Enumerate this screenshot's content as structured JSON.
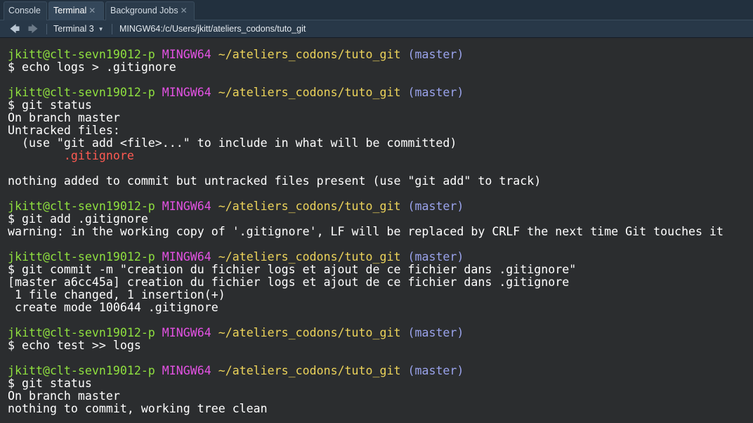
{
  "tabs": [
    {
      "label": "Console",
      "active": false,
      "closable": false
    },
    {
      "label": "Terminal",
      "active": true,
      "closable": true
    },
    {
      "label": "Background Jobs",
      "active": false,
      "closable": true
    }
  ],
  "toolbar": {
    "terminal_name": "Terminal 3",
    "path": "MINGW64:/c/Users/jkitt/ateliers_codons/tuto_git"
  },
  "prompt": {
    "user_host": "jkitt@clt-sevn19012-p",
    "env": "MINGW64",
    "cwd": "~/ateliers_codons/tuto_git",
    "branch": "(master)"
  },
  "lines": [
    "",
    "$ echo logs > .gitignore",
    "",
    "",
    "$ git status",
    "On branch master",
    "Untracked files:",
    "  (use \"git add <file>...\" to include in what will be committed)",
    "        .gitignore",
    "",
    "nothing added to commit but untracked files present (use \"git add\" to track)",
    "",
    "",
    "$ git add .gitignore",
    "warning: in the working copy of '.gitignore', LF will be replaced by CRLF the next time Git touches it",
    "",
    "",
    "$ git commit -m \"creation du fichier logs et ajout de ce fichier dans .gitignore\"",
    "[master a6cc45a] creation du fichier logs et ajout de ce fichier dans .gitignore",
    " 1 file changed, 1 insertion(+)",
    " create mode 100644 .gitignore",
    "",
    "",
    "$ echo test >> logs",
    "",
    "",
    "$ git status",
    "On branch master",
    "nothing to commit, working tree clean"
  ],
  "colors": {
    "user": "#8fe03f",
    "env": "#e352e3",
    "cwd": "#ecd35a",
    "branch": "#9aa3ec",
    "untracked": "#ff5a52"
  },
  "icons": {
    "back": "arrow-left-icon",
    "forward": "arrow-right-icon",
    "dropdown": "chevron-down-icon",
    "close": "close-icon"
  }
}
